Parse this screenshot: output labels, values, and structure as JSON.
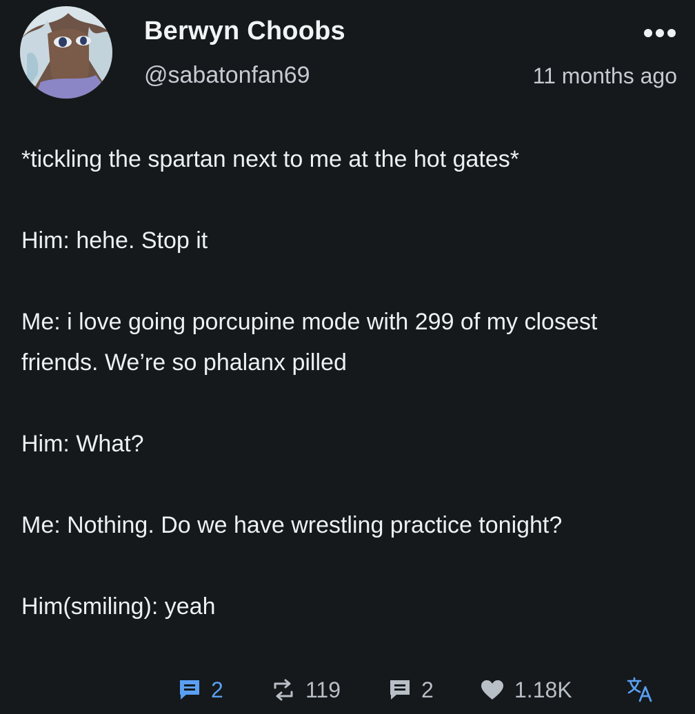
{
  "post": {
    "author": {
      "display_name": "Berwyn Choobs",
      "handle": "@sabatonfan69",
      "avatar_icon": "anime-character-avatar"
    },
    "timestamp": "11 months ago",
    "more_icon": "more-dots-icon",
    "body": [
      "*tickling the spartan next to me at the hot gates*",
      "Him: hehe. Stop it",
      "Me: i love going porcupine mode with 299 of my closest friends. We’re so phalanx pilled",
      "Him: What?",
      "Me: Nothing. Do we have wrestling practice tonight?",
      "Him(smiling): yeah"
    ]
  },
  "actions": {
    "replies": {
      "icon": "reply-icon",
      "count": "2",
      "color": "#5aa0f2"
    },
    "reposts": {
      "icon": "repost-icon",
      "count": "119"
    },
    "quotes": {
      "icon": "quote-icon",
      "count": "2"
    },
    "likes": {
      "icon": "heart-icon",
      "count": "1.18K"
    },
    "translate": {
      "icon": "translate-icon"
    }
  },
  "colors": {
    "background": "#15191c",
    "text": "#eef0f2",
    "muted": "#c6cbd1",
    "accent": "#5aa0f2"
  }
}
